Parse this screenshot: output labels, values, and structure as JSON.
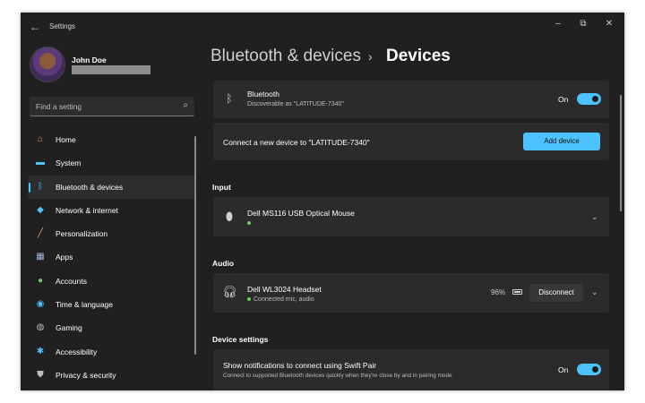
{
  "window": {
    "title": "Settings",
    "minimize": "–",
    "maximize": "⧉",
    "close": "✕"
  },
  "profile": {
    "name": "John Doe",
    "email": ""
  },
  "search": {
    "placeholder": "Find a setting"
  },
  "sidebar": {
    "items": [
      {
        "label": "Home",
        "icon": "home-icon",
        "glyph": "⌂",
        "color": "#e8a06a"
      },
      {
        "label": "System",
        "icon": "system-icon",
        "glyph": "▬",
        "color": "#4cc2ff"
      },
      {
        "label": "Bluetooth & devices",
        "icon": "bluetooth-icon",
        "glyph": "ᛒ",
        "color": "#4cc2ff",
        "active": true
      },
      {
        "label": "Network & internet",
        "icon": "wifi-icon",
        "glyph": "◆",
        "color": "#4cc2ff"
      },
      {
        "label": "Personalization",
        "icon": "brush-icon",
        "glyph": "╱",
        "color": "#e8a06a"
      },
      {
        "label": "Apps",
        "icon": "apps-icon",
        "glyph": "▦",
        "color": "#9fb6d6"
      },
      {
        "label": "Accounts",
        "icon": "accounts-icon",
        "glyph": "●",
        "color": "#6ccb5f"
      },
      {
        "label": "Time & language",
        "icon": "globe-icon",
        "glyph": "◉",
        "color": "#4cc2ff"
      },
      {
        "label": "Gaming",
        "icon": "gamepad-icon",
        "glyph": "◍",
        "color": "#bdbdbd"
      },
      {
        "label": "Accessibility",
        "icon": "accessibility-icon",
        "glyph": "✱",
        "color": "#4cc2ff"
      },
      {
        "label": "Privacy & security",
        "icon": "shield-icon",
        "glyph": "⛊",
        "color": "#bdbdbd"
      }
    ]
  },
  "breadcrumb": {
    "parent": "Bluetooth & devices",
    "separator": "›",
    "current": "Devices"
  },
  "bluetooth_card": {
    "title": "Bluetooth",
    "subtitle": "Discoverable as \"LATITUDE-7340\"",
    "toggle_label": "On",
    "toggle_on": true
  },
  "connect_card": {
    "text": "Connect a new device to \"LATITUDE-7340\"",
    "button": "Add device"
  },
  "input_section": {
    "heading": "Input",
    "device": {
      "name": "Dell MS116 USB Optical Mouse",
      "status": ""
    }
  },
  "audio_section": {
    "heading": "Audio",
    "device": {
      "name": "Dell WL3024 Headset",
      "status": "Connected mic, audio",
      "battery": "96%",
      "button": "Disconnect"
    }
  },
  "device_settings": {
    "heading": "Device settings",
    "swift_pair": {
      "title": "Show notifications to connect using Swift Pair",
      "subtitle": "Connect to supported Bluetooth devices quickly when they're close by and in pairing mode",
      "toggle_label": "On",
      "toggle_on": true
    }
  },
  "colors": {
    "accent": "#4cc2ff",
    "background": "#202020",
    "card": "#2b2b2b",
    "status_green": "#6ccb5f"
  }
}
